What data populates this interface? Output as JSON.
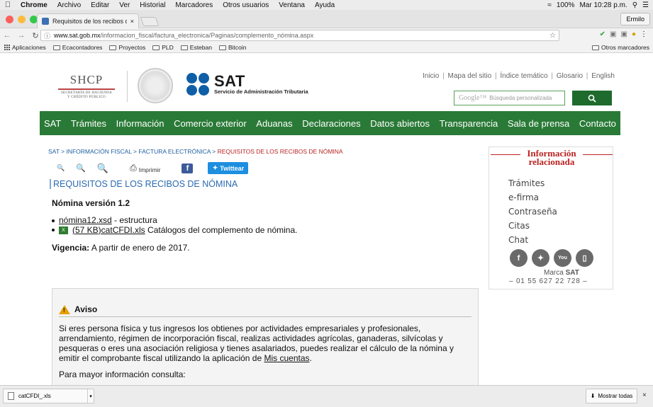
{
  "menubar": {
    "app": "Chrome",
    "items": [
      "Archivo",
      "Editar",
      "Ver",
      "Historial",
      "Marcadores",
      "Otros usuarios",
      "Ventana",
      "Ayuda"
    ],
    "battery": "100%",
    "clock": "Mar 10:28 p.m."
  },
  "browser": {
    "tab_title": "Requisitos de los recibos de n",
    "profile": "Ermilo",
    "url_host": "www.sat.gob.mx",
    "url_path": "/informacion_fiscal/factura_electronica/Paginas/complemento_nómina.aspx"
  },
  "bookmarks": {
    "apps": "Aplicaciones",
    "items": [
      "Ecacontadores",
      "Proyectos",
      "PLD",
      "Esteban",
      "Bitcoin"
    ],
    "other": "Otros marcadores"
  },
  "header": {
    "shcp_big": "SHCP",
    "shcp_small1": "SECRETARÍA DE HACIENDA",
    "shcp_small2": "Y CRÉDITO PÚBLICO",
    "sat_word": "SAT",
    "sat_sub": "Servicio de Administración Tributaria",
    "toplinks": [
      "Inicio",
      "Mapa del sitio",
      "Índice temático",
      "Glosario",
      "English"
    ],
    "search_brand": "Google™",
    "search_placeholder": "Búsqueda personalizada"
  },
  "nav": [
    "SAT",
    "Trámites",
    "Información",
    "Comercio exterior",
    "Aduanas",
    "Declaraciones",
    "Datos abiertos",
    "Transparencia",
    "Sala de prensa",
    "Contacto"
  ],
  "breadcrumb": [
    "SAT",
    "INFORMACIÓN FISCAL",
    "FACTURA ELECTRÓNICA",
    "REQUISITOS DE LOS RECIBOS DE NÓMINA"
  ],
  "tools": {
    "print": "Imprimir",
    "twitter": "Twittear"
  },
  "main": {
    "title": "REQUISITOS DE LOS RECIBOS DE NÓMINA",
    "version": "Nómina versión 1.2",
    "file1_link": "nómina12.xsd",
    "file1_desc": " - estructura",
    "file2_link": "(57 KB)catCFDI.xls",
    "file2_desc": " Catálogos del complemento de nómina.",
    "vigencia_label": "Vigencia:",
    "vigencia_text": " A partir de enero de 2017."
  },
  "aviso": {
    "title": "Aviso",
    "body_pre": "Si eres persona física y tus ingresos los obtienes por actividades empresariales y profesionales, arrendamiento, régimen de incorporación fiscal, realizas actividades agrícolas, ganaderas, silvícolas y pesqueras o eres una asociación religiosa y tienes asalariados, puedes realizar el cálculo de la nómina y emitir el comprobante fiscal utilizando la aplicación de ",
    "body_link": "Mis cuentas",
    "body_post": ".",
    "more": "Para mayor información consulta:"
  },
  "sidebar": {
    "title1": "Información",
    "title2": "relacionada",
    "links": [
      "Trámites",
      "e-firma",
      "Contraseña",
      "Citas",
      "Chat"
    ],
    "marca_pre": "Marca ",
    "marca_bold": "SAT",
    "phone": "–  01 55 627 22 728  –"
  },
  "downloads": {
    "file": "catCFDI_.xls",
    "show_all": "Mostrar todas"
  },
  "colors": {
    "nav_green": "#2a7a37",
    "sat_blue": "#0f5fa8",
    "accent_red": "#b22222"
  }
}
